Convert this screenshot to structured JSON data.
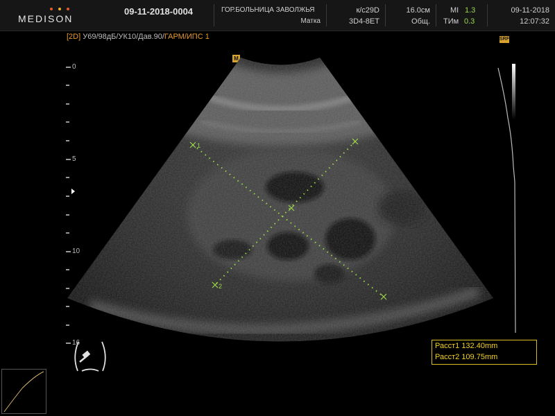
{
  "header": {
    "brand": "MEDISON",
    "patient_id": "09-11-2018-0004",
    "hospital": "ГОР.БОЛЬНИЦА ЗАВОЛЖЬЯ",
    "exam": "Матка",
    "frequency": "к/с29D",
    "probe": "3D4-8ET",
    "depth": "16.0см",
    "preset": "Общ.",
    "mi_label": "MI",
    "mi_value": "1.3",
    "tim_label": "ТИм",
    "tim_value": "0.3",
    "date": "09-11-2018",
    "time": "12:07:32"
  },
  "params": {
    "mode": "[2D]",
    "settings": "У69/98дБ/УК10/Дав.90/",
    "harmonic": "ГАРМ/ИПС 1"
  },
  "depth_scale": {
    "labels": [
      "0",
      "5",
      "10",
      "16"
    ]
  },
  "markers": {
    "caliper1": "1",
    "caliper2": "2",
    "probe_mark": "M",
    "overlay_badge": "SRF"
  },
  "measurements": [
    {
      "label": "Расст1",
      "value": "132.40mm"
    },
    {
      "label": "Расст2",
      "value": "109.75mm"
    }
  ],
  "colors": {
    "caliper_green": "#9bd84a",
    "measure_yellow": "#f3d320",
    "mode_orange": "#e69a2e",
    "logo_dots": [
      "#e05a2a",
      "#f0b030",
      "#e05a2a"
    ]
  },
  "icons": [
    "body-marker-icon",
    "gain-curve-icon",
    "grayscale-bar-icon",
    "focus-marker-icon"
  ]
}
